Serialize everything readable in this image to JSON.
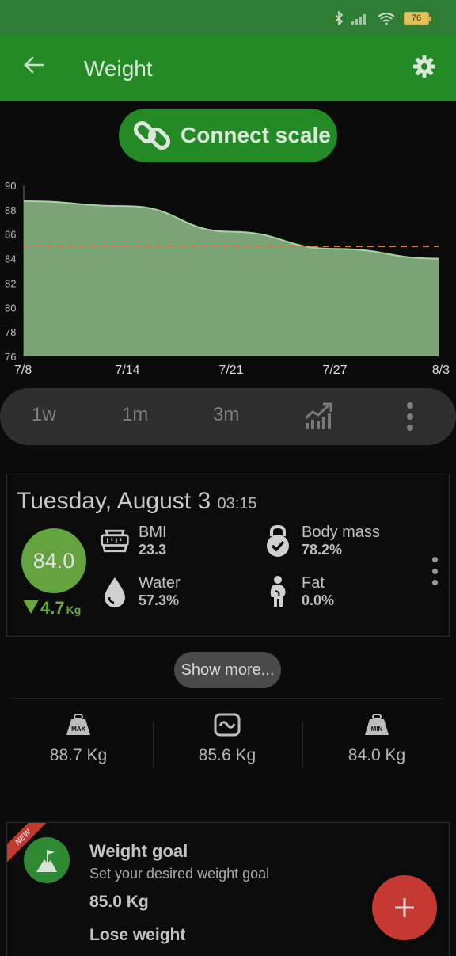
{
  "status_bar": {
    "battery": "76"
  },
  "app_bar": {
    "title": "Weight",
    "back_icon": "arrow-back-icon",
    "settings_icon": "gear-icon"
  },
  "connect": {
    "label": "Connect scale",
    "icon": "link-icon"
  },
  "chart_data": {
    "type": "area",
    "x": [
      "7/8",
      "7/14",
      "7/21",
      "7/27",
      "8/3"
    ],
    "y_series": [
      88.7,
      88.3,
      86.2,
      84.8,
      84.0
    ],
    "reference_line": 85.0,
    "y_ticks": [
      "90",
      "88",
      "86",
      "84",
      "82",
      "80",
      "78",
      "76"
    ],
    "x_ticks": [
      "7/8",
      "7/14",
      "7/21",
      "7/27",
      "8/3"
    ],
    "ylim": [
      76,
      90
    ],
    "fill_color": "#8fc08a",
    "reference_color": "#e0703a"
  },
  "range": {
    "items": [
      "1w",
      "1m",
      "3m"
    ],
    "trend_icon": "trend-chart-icon",
    "more_icon": "more-vert-icon"
  },
  "entry": {
    "date": "Tuesday, August 3",
    "time": "03:15",
    "weight": "84.0",
    "change": "4.7",
    "change_unit": "Kg",
    "metrics": [
      {
        "label": "BMI",
        "value": "23.3",
        "icon": "scale-belt-icon"
      },
      {
        "label": "Body mass",
        "value": "78.2%",
        "icon": "kettlebell-icon"
      },
      {
        "label": "Water",
        "value": "57.3%",
        "icon": "water-drop-icon"
      },
      {
        "label": "Fat",
        "value": "0.0%",
        "icon": "body-fat-icon"
      }
    ]
  },
  "show_more": "Show more...",
  "stats": [
    {
      "icon": "max-weight-icon",
      "icon_text": "MAX",
      "value": "88.7 Kg"
    },
    {
      "icon": "average-weight-icon",
      "icon_text": "~",
      "value": "85.6 Kg"
    },
    {
      "icon": "min-weight-icon",
      "icon_text": "MIN",
      "value": "84.0 Kg"
    }
  ],
  "goal": {
    "ribbon": "NEW",
    "title": "Weight goal",
    "subtitle": "Set your desired weight goal",
    "target": "85.0 Kg",
    "mode": "Lose weight"
  },
  "fab": {
    "icon": "plus-icon"
  },
  "colors": {
    "primary": "#248a26",
    "weight_badge": "#62a33e",
    "fab": "#c43a33"
  }
}
